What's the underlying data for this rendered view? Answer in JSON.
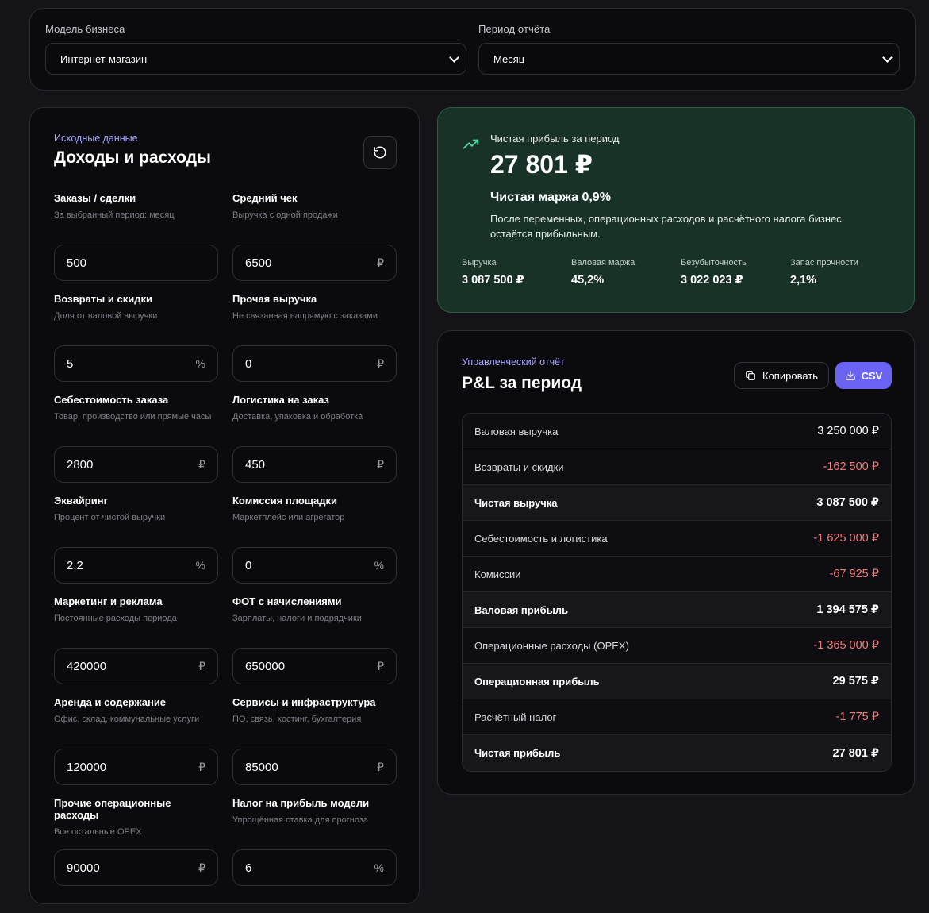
{
  "top_bar": {
    "business_model": {
      "label": "Модель бизнеса",
      "value": "Интернет-магазин"
    },
    "period": {
      "label": "Период отчёта",
      "value": "Месяц"
    }
  },
  "inputs": {
    "eyebrow": "Исходные данные",
    "title": "Доходы и расходы",
    "reset_icon": "reset-icon",
    "fields": [
      {
        "label": "Заказы / сделки",
        "hint": "За выбранный период: месяц",
        "value": "500",
        "unit": ""
      },
      {
        "label": "Средний чек",
        "hint": "Выручка с одной продажи",
        "value": "6500",
        "unit": "₽"
      },
      {
        "label": "Возвраты и скидки",
        "hint": "Доля от валовой выручки",
        "value": "5",
        "unit": "%"
      },
      {
        "label": "Прочая выручка",
        "hint": "Не связанная напрямую с заказами",
        "value": "0",
        "unit": "₽"
      },
      {
        "label": "Себестоимость заказа",
        "hint": "Товар, производство или прямые часы",
        "value": "2800",
        "unit": "₽"
      },
      {
        "label": "Логистика на заказ",
        "hint": "Доставка, упаковка и обработка",
        "value": "450",
        "unit": "₽"
      },
      {
        "label": "Эквайринг",
        "hint": "Процент от чистой выручки",
        "value": "2,2",
        "unit": "%"
      },
      {
        "label": "Комиссия площадки",
        "hint": "Маркетплейс или агрегатор",
        "value": "0",
        "unit": "%"
      },
      {
        "label": "Маркетинг и реклама",
        "hint": "Постоянные расходы периода",
        "value": "420000",
        "unit": "₽"
      },
      {
        "label": "ФОТ с начислениями",
        "hint": "Зарплаты, налоги и подрядчики",
        "value": "650000",
        "unit": "₽"
      },
      {
        "label": "Аренда и содержание",
        "hint": "Офис, склад, коммунальные услуги",
        "value": "120000",
        "unit": "₽"
      },
      {
        "label": "Сервисы и инфраструктура",
        "hint": "ПО, связь, хостинг, бухгалтерия",
        "value": "85000",
        "unit": "₽"
      },
      {
        "label": "Прочие операционные расходы",
        "hint": "Все остальные OPEX",
        "value": "90000",
        "unit": "₽"
      },
      {
        "label": "Налог на прибыль модели",
        "hint": "Упрощённая ставка для прогноза",
        "value": "6",
        "unit": "%"
      }
    ]
  },
  "summary": {
    "icon": "trending-up-icon",
    "label": "Чистая прибыль за период",
    "value": "27 801 ₽",
    "margin": "Чистая маржа 0,9%",
    "description": "После переменных, операционных расходов и расчётного налога бизнес остаётся прибыльным.",
    "accent_color": "#183228",
    "kpis": [
      {
        "label": "Выручка",
        "value": "3 087 500 ₽"
      },
      {
        "label": "Валовая маржа",
        "value": "45,2%"
      },
      {
        "label": "Безубыточность",
        "value": "3 022 023 ₽"
      },
      {
        "label": "Запас прочности",
        "value": "2,1%"
      }
    ]
  },
  "pl": {
    "eyebrow": "Управленческий отчёт",
    "title": "P&L за период",
    "copy_label": "Копировать",
    "csv_label": "CSV",
    "csv_color": "#6b63f4",
    "negative_color": "#f07c7c",
    "rows": [
      {
        "label": "Валовая выручка",
        "amount": "3 250 000 ₽"
      },
      {
        "label": "Возвраты и скидки",
        "amount": "-162 500 ₽"
      },
      {
        "label": "Чистая выручка",
        "amount": "3 087 500 ₽"
      },
      {
        "label": "Себестоимость и логистика",
        "amount": "-1 625 000 ₽"
      },
      {
        "label": "Комиссии",
        "amount": "-67 925 ₽"
      },
      {
        "label": "Валовая прибыль",
        "amount": "1 394 575 ₽"
      },
      {
        "label": "Операционные расходы (OPEX)",
        "amount": "-1 365 000 ₽"
      },
      {
        "label": "Операционная прибыль",
        "amount": "29 575 ₽"
      },
      {
        "label": "Расчётный налог",
        "amount": "-1 775 ₽"
      },
      {
        "label": "Чистая прибыль",
        "amount": "27 801 ₽"
      }
    ]
  }
}
